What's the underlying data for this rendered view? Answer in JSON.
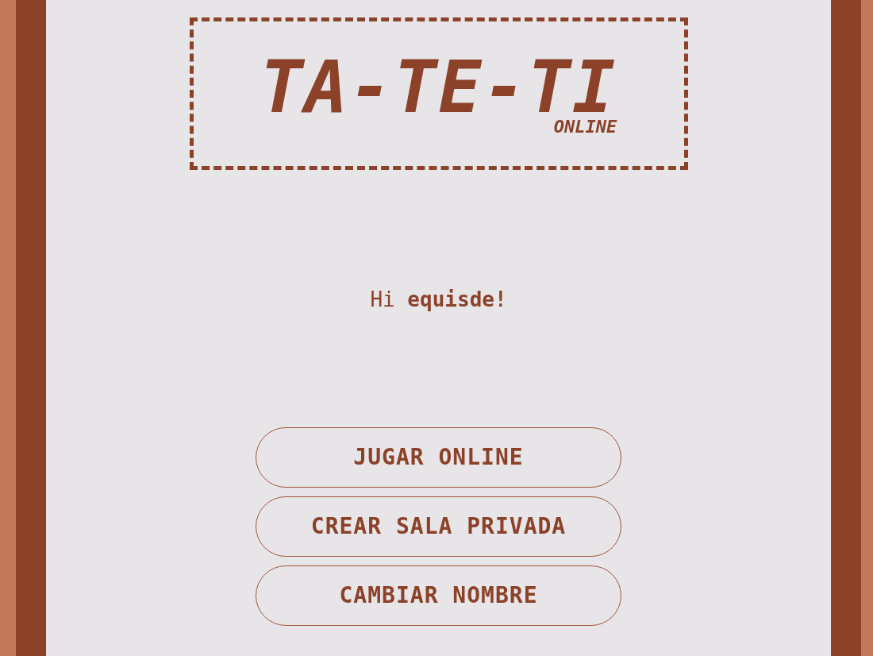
{
  "logo": {
    "title": "TA-TE-TI",
    "subtitle": "ONLINE"
  },
  "greeting": "Hi **equisde!**",
  "buttons": [
    {
      "label": "JUGAR ONLINE"
    },
    {
      "label": "CREAR SALA PRIVADA"
    },
    {
      "label": "CAMBIAR NOMBRE"
    }
  ]
}
